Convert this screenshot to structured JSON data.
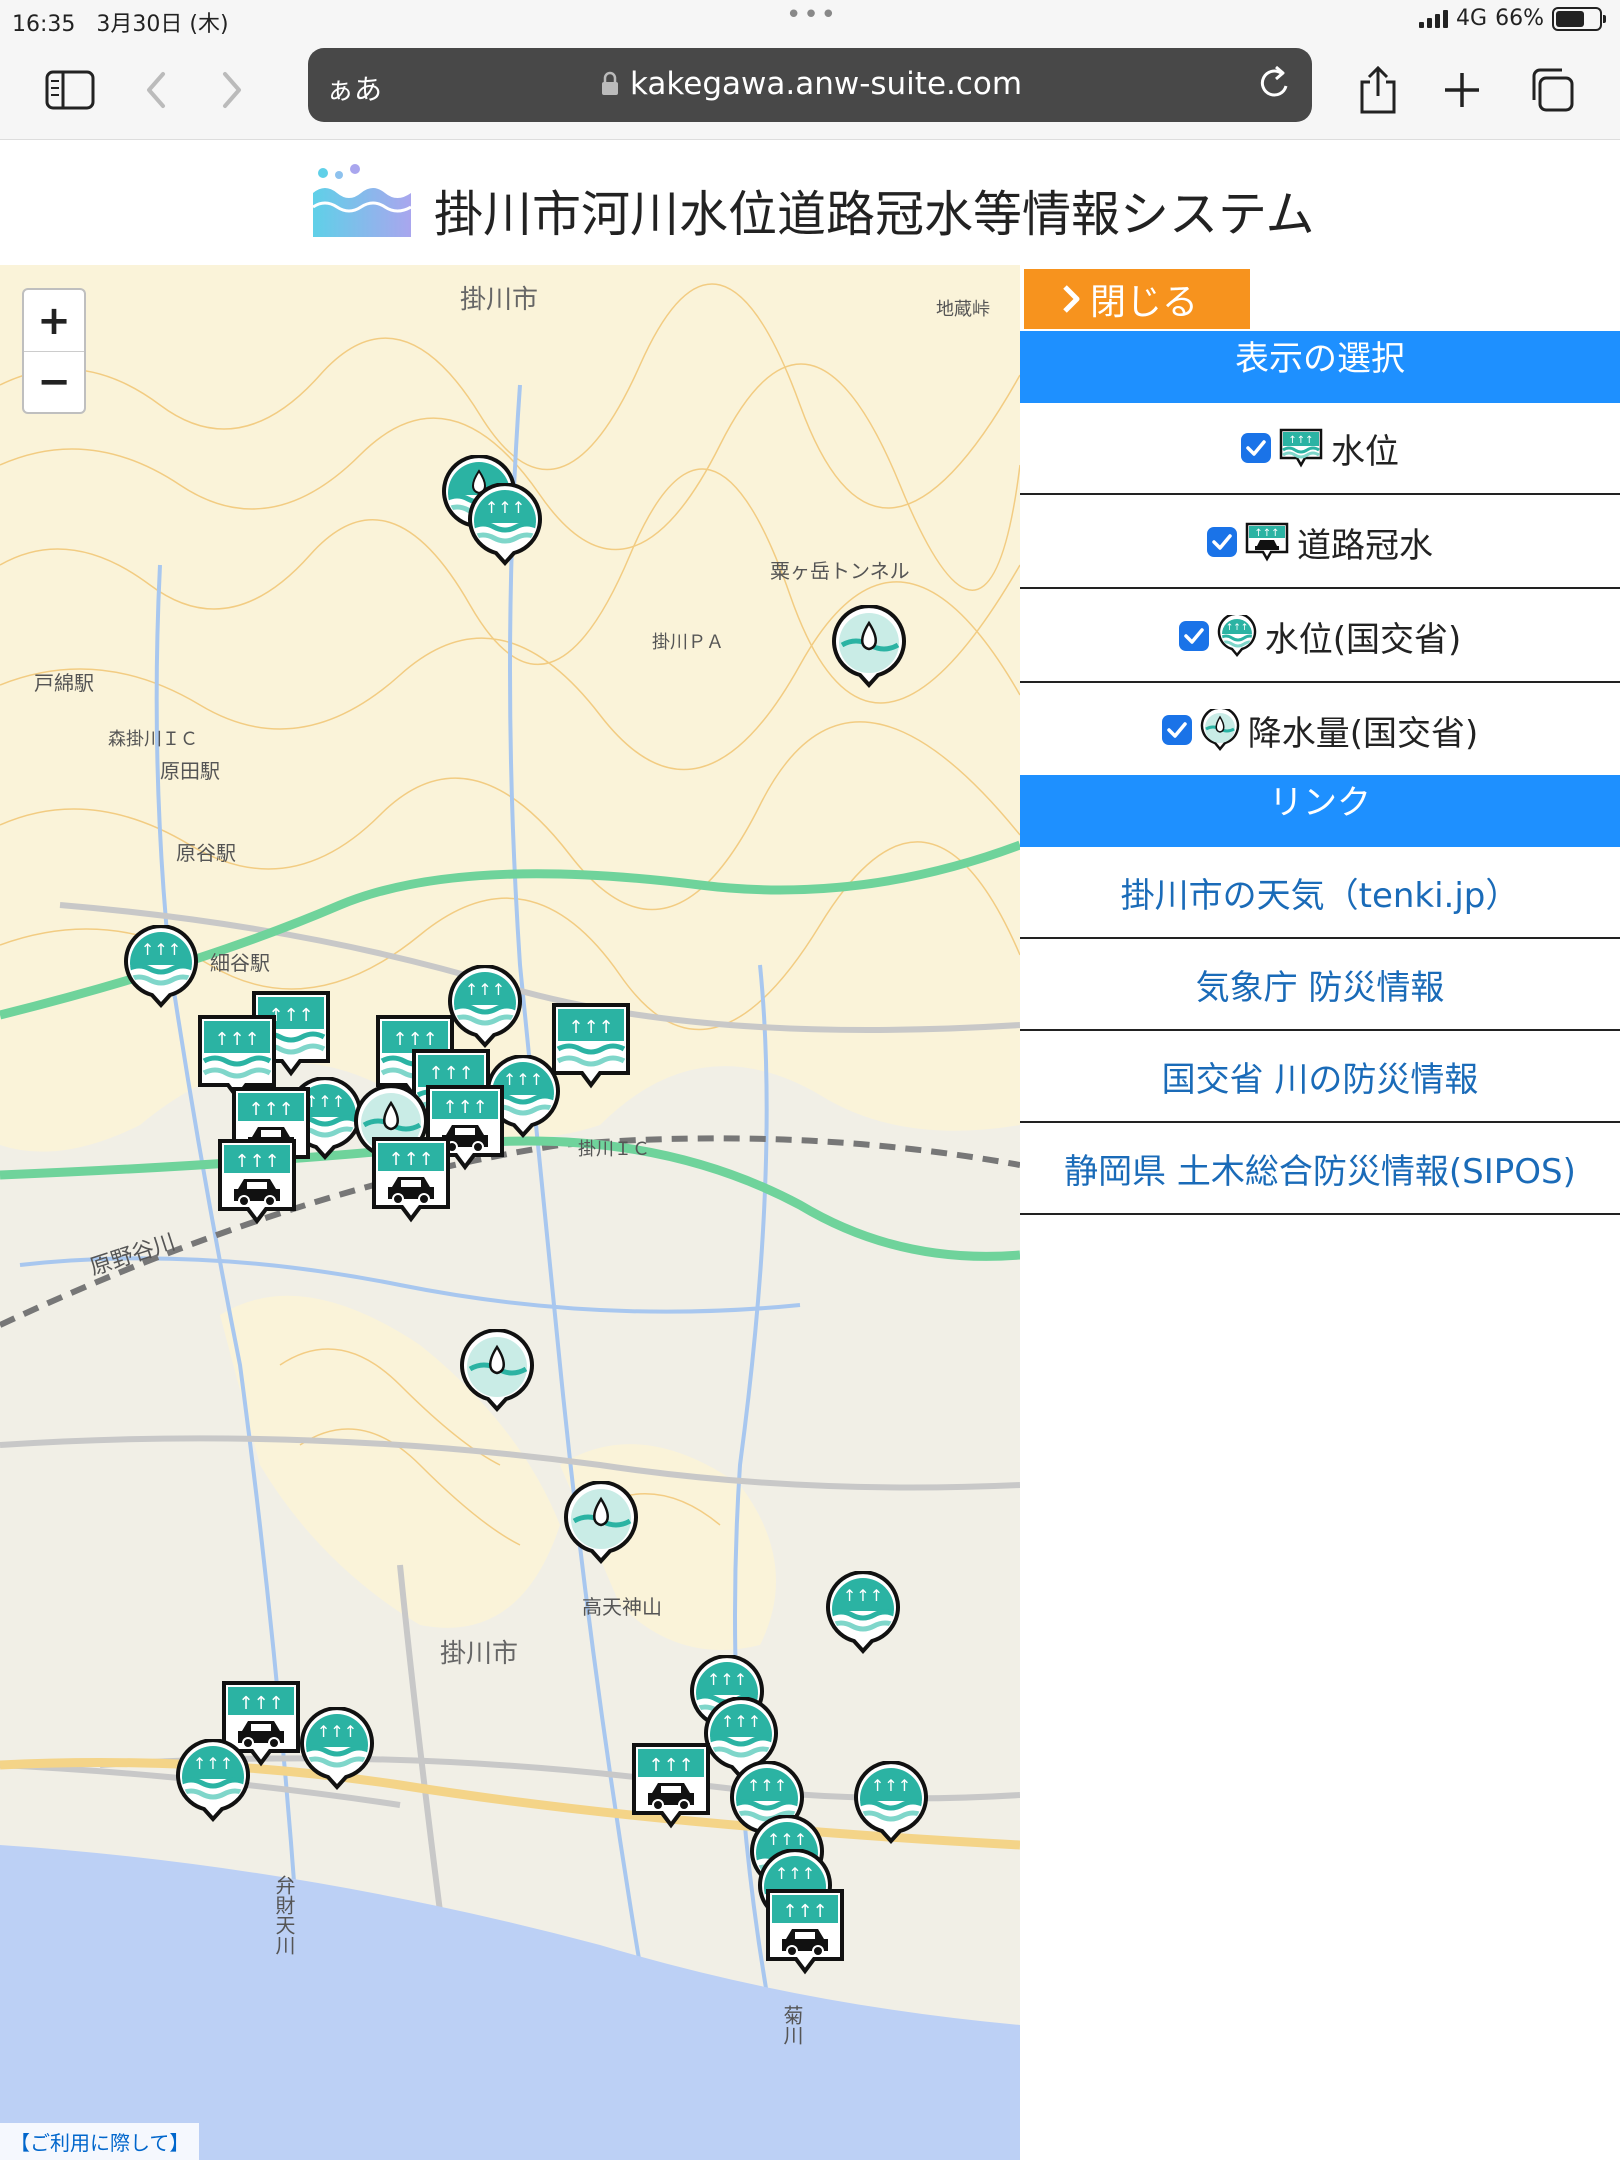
{
  "status_bar": {
    "time": "16:35",
    "date": "3月30日 (木)",
    "dots": "•••",
    "network": "4G",
    "battery": "66%"
  },
  "browser": {
    "aa_label": "ぁあ",
    "url": "kakegawa.anw-suite.com",
    "icons": [
      "sidebar-icon",
      "back-icon",
      "forward-icon",
      "lock-icon",
      "reload-icon",
      "share-icon",
      "new-tab-icon",
      "tabs-icon"
    ]
  },
  "header": {
    "title": "掛川市河川水位道路冠水等情報システム"
  },
  "map": {
    "zoom_in": "+",
    "zoom_out": "−",
    "attribution": "【ご利用に際して】",
    "labels": [
      {
        "text": "掛川市"
      },
      {
        "text": "地蔵峠"
      },
      {
        "text": "粟ヶ岳トンネル"
      },
      {
        "text": "掛川ＰＡ"
      },
      {
        "text": "戸綿駅"
      },
      {
        "text": "森掛川ＩＣ"
      },
      {
        "text": "原田駅"
      },
      {
        "text": "原谷駅"
      },
      {
        "text": "細谷駅"
      },
      {
        "text": "掛川ＩＣ"
      },
      {
        "text": "原野谷川"
      },
      {
        "text": "高天神山"
      },
      {
        "text": "掛川市"
      },
      {
        "text": "弁財天川"
      },
      {
        "text": "菊川"
      }
    ]
  },
  "panel": {
    "close_label": "閉じる",
    "display_section": "表示の選択",
    "layers": [
      {
        "label": "水位",
        "checked": true,
        "icon": "water-level-square-icon"
      },
      {
        "label": "道路冠水",
        "checked": true,
        "icon": "road-flood-icon"
      },
      {
        "label": "水位(国交省)",
        "checked": true,
        "icon": "water-level-round-icon"
      },
      {
        "label": "降水量(国交省)",
        "checked": true,
        "icon": "rainfall-icon"
      }
    ],
    "link_section": "リンク",
    "links": [
      {
        "label": "掛川市の天気（tenki.jp）"
      },
      {
        "label": "気象庁 防災情報"
      },
      {
        "label": "国交省 川の防災情報"
      },
      {
        "label": "静岡県 土木総合防災情報(SIPOS)"
      }
    ]
  },
  "colors": {
    "accent_orange": "#f7931e",
    "section_blue": "#1e90ff",
    "link_blue": "#1a6bb8",
    "marker_teal": "#2bb3a3",
    "sea_blue": "#bcd0f5",
    "expressway_green": "#6fd39b"
  }
}
